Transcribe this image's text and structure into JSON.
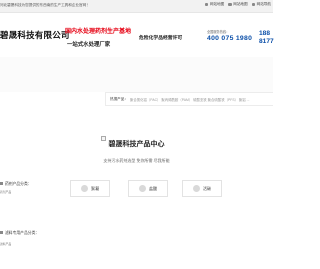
{
  "topbar": {
    "welcome": "河北碧晟科技为您提供的东西南的生产工具和企业官网！",
    "links": [
      {
        "label": "网站地图",
        "icon": "map-icon"
      },
      {
        "label": "网站地图",
        "icon": "sitemap-icon"
      },
      {
        "label": "网站导航",
        "icon": "nav-icon"
      }
    ]
  },
  "header": {
    "company": "碧晟科技有限公司",
    "slogan_red": "国内水处理药剂生产基地",
    "slogan_black": "一站式水处理厂家",
    "license": "危险化学品经营许可",
    "hotline_label": "全国服务热线：",
    "hotline": "400 075 1980",
    "phone2_line1": "188",
    "phone2_line2": "8177"
  },
  "search": {
    "label": "热搜产品：",
    "words": "聚合氯化铝（PAC）  聚丙烯酰胺（PAM）  硫酸亚铁  聚合硫酸铁（PFS）  聚铝  ..."
  },
  "products": {
    "title": "碧晟科技产品中心",
    "subtitle": "支持污水药剂选型 免你所需 尽我所能"
  },
  "categories": [
    {
      "label": "药剂产品分类：",
      "sub": "药剂产品"
    },
    {
      "label": "滤料专用产品分类：",
      "sub": "滤料产品"
    }
  ],
  "filters": [
    {
      "label": "絮凝"
    },
    {
      "label": "盐酸"
    },
    {
      "label": "活碳"
    }
  ],
  "colors": {
    "accent_red": "#e60012",
    "hotline_blue": "#0a4ea8"
  }
}
